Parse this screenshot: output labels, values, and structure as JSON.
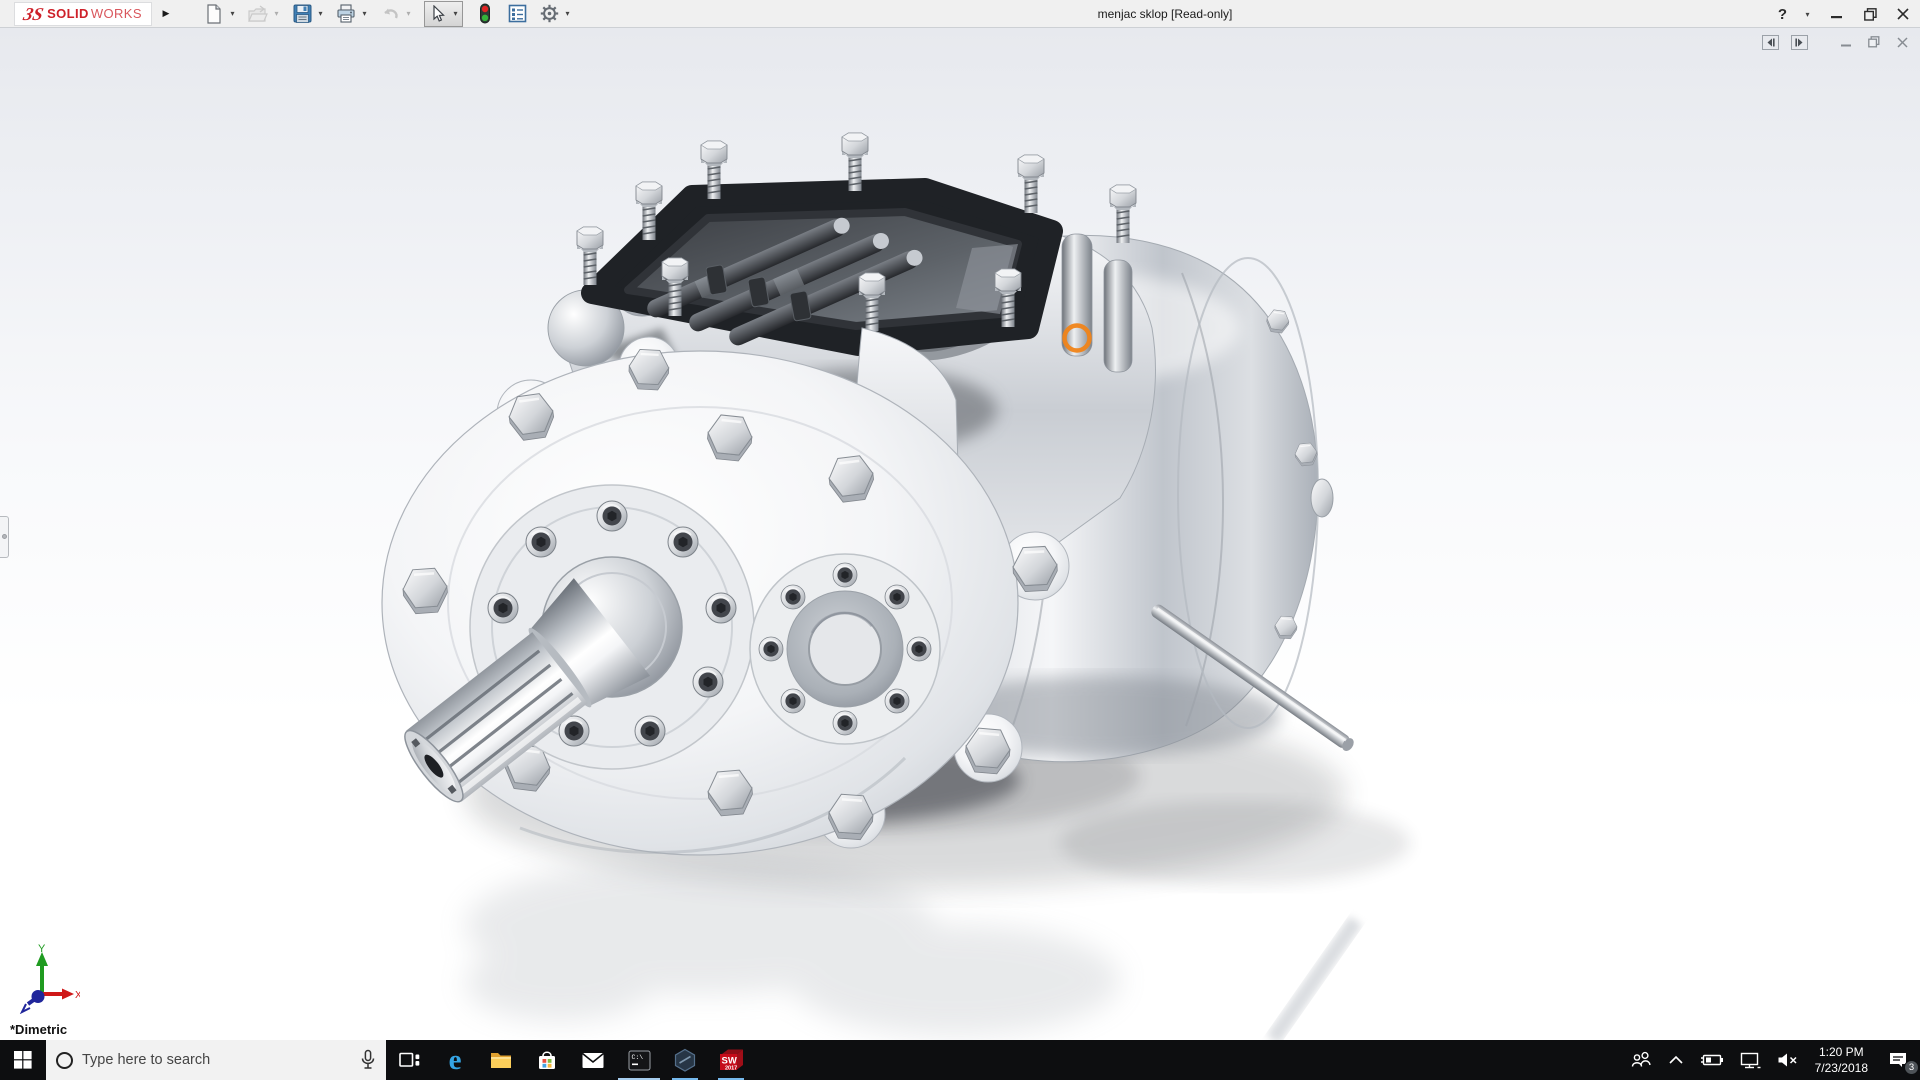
{
  "colors": {
    "accent-orange": "#F08419",
    "logo-red": "#CE2029",
    "taskbar-bg": "#0D0E10",
    "running-underline": "#76B9ED",
    "titlebar-bg": "#F0F0F0"
  },
  "window": {
    "title": "menjac sklop [Read-only]",
    "help_label": "?",
    "logo": {
      "mark": "3S",
      "solid": "SOLID",
      "works": "WORKS"
    }
  },
  "icons": {
    "caret": "▾",
    "menu_expand": "▶",
    "edge": "e",
    "cmd": "C:\\"
  },
  "toolbar": {
    "tools": [
      {
        "name": "new-document",
        "enabled": true,
        "has_dropdown": true
      },
      {
        "name": "open",
        "enabled": false,
        "has_dropdown": true
      },
      {
        "name": "save",
        "enabled": true,
        "has_dropdown": true
      },
      {
        "name": "print",
        "enabled": true,
        "has_dropdown": true
      },
      {
        "name": "undo",
        "enabled": false,
        "has_dropdown": true
      },
      {
        "name": "select",
        "enabled": true,
        "has_dropdown": true,
        "active": true
      },
      {
        "name": "rebuild-traffic-light",
        "enabled": true,
        "has_dropdown": false
      },
      {
        "name": "file-properties",
        "enabled": true,
        "has_dropdown": false
      },
      {
        "name": "options",
        "enabled": true,
        "has_dropdown": true
      }
    ]
  },
  "viewport": {
    "view_label": "*Dimetric",
    "triad": {
      "x": "X",
      "y": "Y"
    }
  },
  "taskbar": {
    "search_placeholder": "Type here to search",
    "clock": {
      "time": "1:20 PM",
      "date": "7/23/2018"
    },
    "action_center_badge": "3",
    "sw_label": "SW",
    "sw_year": "2017",
    "apps": [
      {
        "name": "task-view",
        "running": false
      },
      {
        "name": "microsoft-edge",
        "running": false
      },
      {
        "name": "file-explorer",
        "running": false
      },
      {
        "name": "microsoft-store",
        "running": false
      },
      {
        "name": "mail",
        "running": false
      },
      {
        "name": "command-prompt",
        "running": true
      },
      {
        "name": "dev-hexagon-app",
        "running": true
      },
      {
        "name": "solidworks-2017",
        "running": true
      }
    ]
  }
}
